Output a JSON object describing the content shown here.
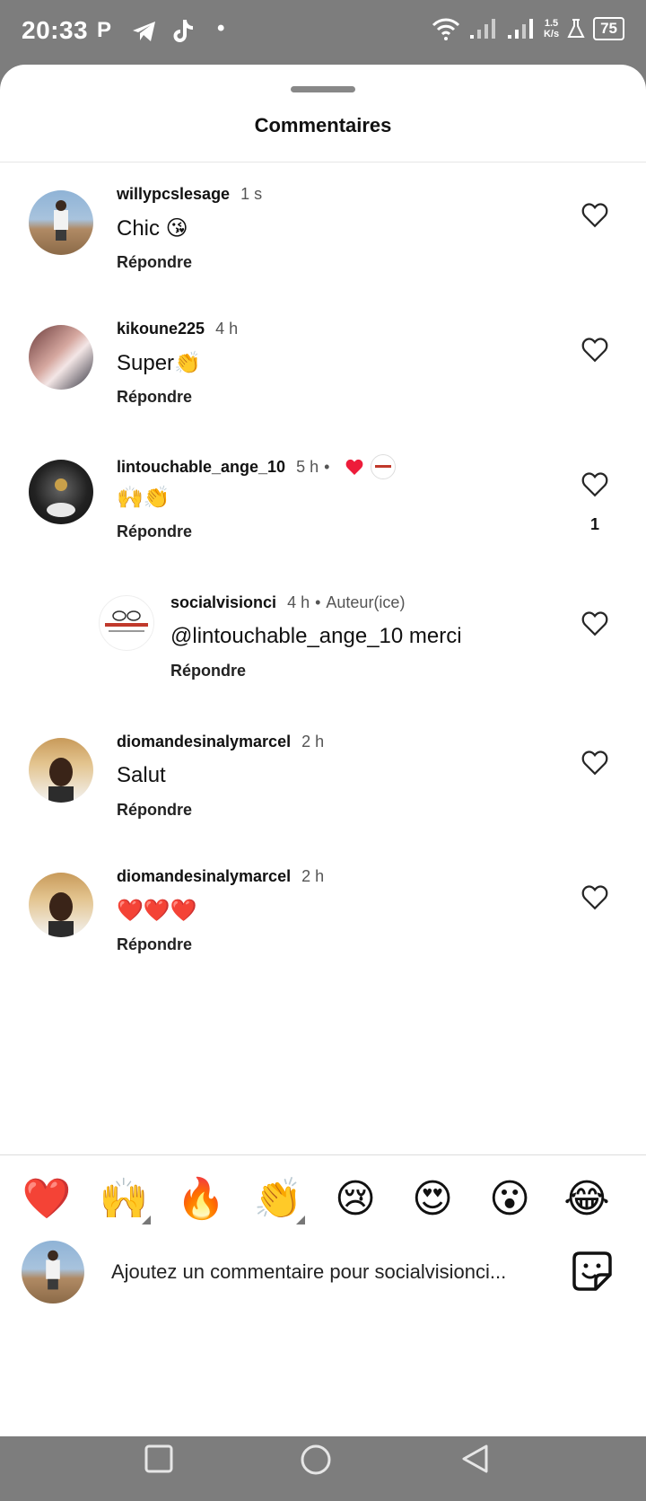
{
  "status_bar": {
    "time": "20:33",
    "app_icons": [
      "P",
      "telegram-icon",
      "tiktok-icon",
      "•"
    ],
    "net_speed_value": "1.5",
    "net_speed_unit": "K/s",
    "battery": "75"
  },
  "sheet": {
    "title": "Commentaires"
  },
  "comments": [
    {
      "user": "willypcslesage",
      "time": "1 s",
      "text": "Chic 😘",
      "reply": "Répondre"
    },
    {
      "user": "kikoune225",
      "time": "4 h",
      "text": "Super👏",
      "reply": "Répondre"
    },
    {
      "user": "lintouchable_ange_10",
      "time": "5 h",
      "separator": "•",
      "text": "🙌👏",
      "reply": "Répondre",
      "likes": "1"
    },
    {
      "user": "socialvisionci",
      "time": "4 h",
      "separator": "•",
      "badge": "Auteur(ice)",
      "text": "@lintouchable_ange_10  merci",
      "reply": "Répondre"
    },
    {
      "user": "diomandesinalymarcel",
      "time": "2 h",
      "text": "Salut",
      "reply": "Répondre"
    },
    {
      "user": "diomandesinalymarcel",
      "time": "2 h",
      "text": "❤️❤️❤️",
      "reply": "Répondre"
    }
  ],
  "quick_emojis": [
    "❤️",
    "🙌",
    "🔥",
    "👏",
    "😢",
    "😍",
    "😮",
    "😂"
  ],
  "composer": {
    "placeholder": "Ajoutez un commentaire pour socialvisionci..."
  },
  "colors": {
    "heart_red": "#ed1c3a",
    "outline": "#262626",
    "status_bg": "#7d7d7d"
  }
}
